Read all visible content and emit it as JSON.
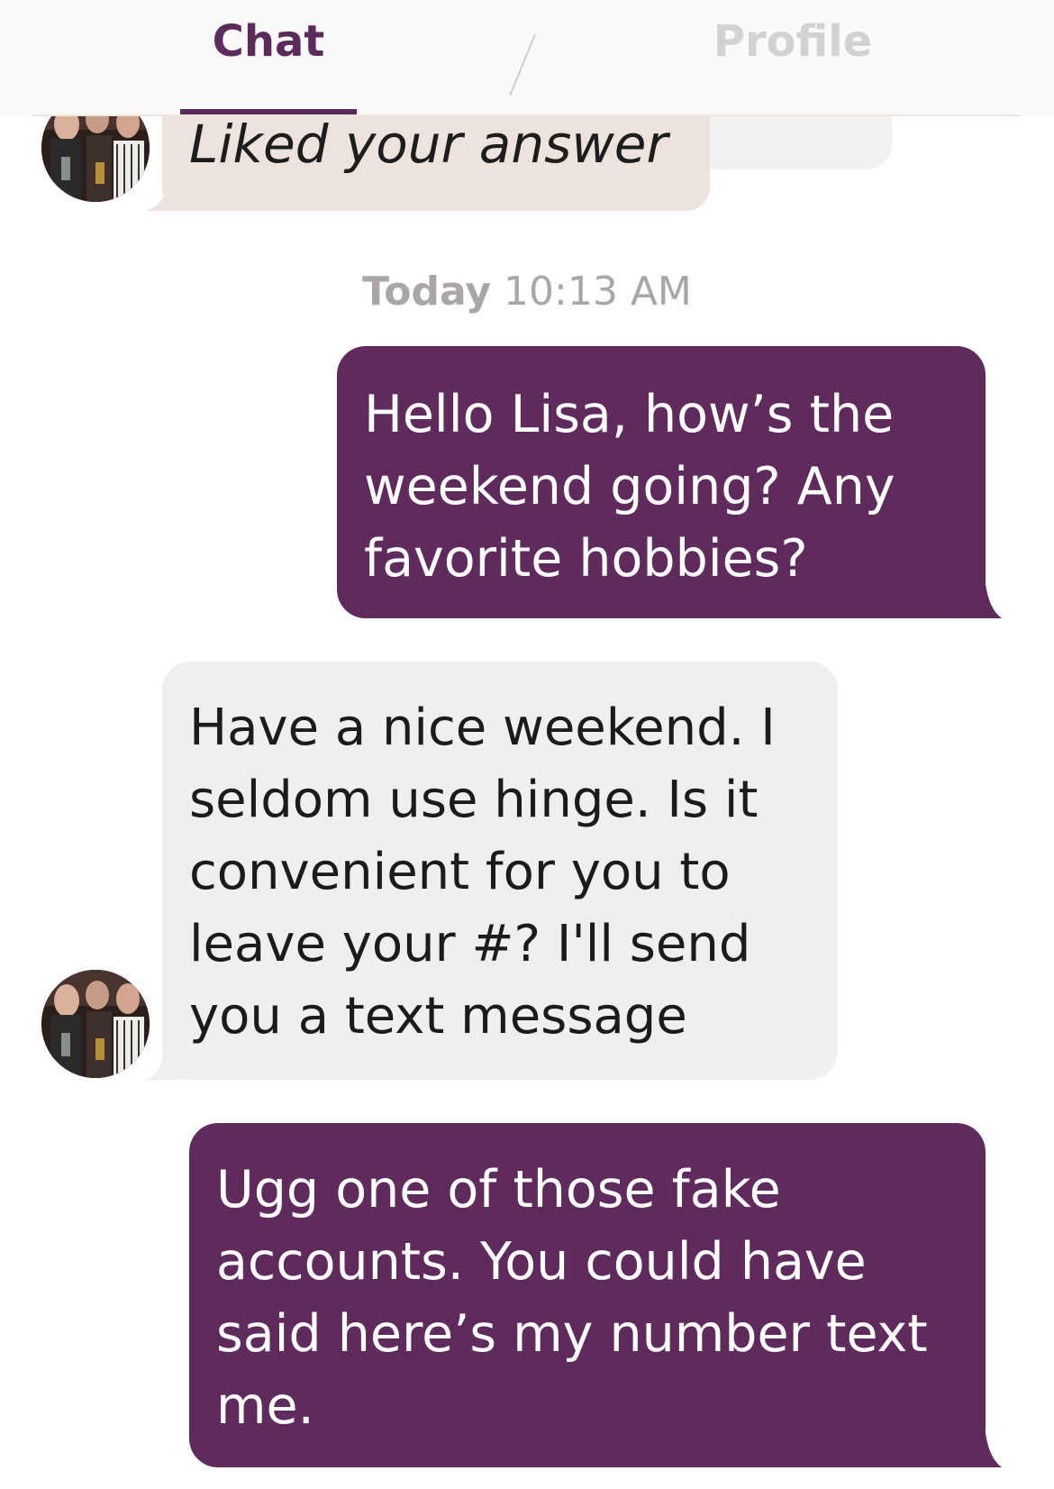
{
  "header": {
    "tabs": [
      {
        "label": "Chat",
        "active": true
      },
      {
        "label": "Profile",
        "active": false
      }
    ]
  },
  "colors": {
    "accent": "#5e2b5c",
    "outgoing_bubble": "#5e2b5c",
    "incoming_bubble": "#efefef",
    "liked_bubble": "#ece3de",
    "inactive_tab": "#d4d1d1"
  },
  "messages": {
    "liked": {
      "text": "Liked your answer",
      "avatar_icon": "contact-photo"
    },
    "timestamp": {
      "day": "Today",
      "time": "10:13 AM"
    },
    "outgoing_1": {
      "lines": [
        "Hello Lisa, how’s the",
        "weekend going?  Any",
        "favorite hobbies?"
      ]
    },
    "incoming_1": {
      "lines": [
        "Have a nice weekend. I",
        "seldom use hinge. Is it",
        "convenient for you to",
        "leave your #? I'll send",
        "you a text message"
      ],
      "avatar_icon": "contact-photo"
    },
    "outgoing_2": {
      "lines": [
        "Ugg one of those fake",
        "accounts.  You could have",
        "said here’s my number text",
        "me."
      ]
    }
  }
}
